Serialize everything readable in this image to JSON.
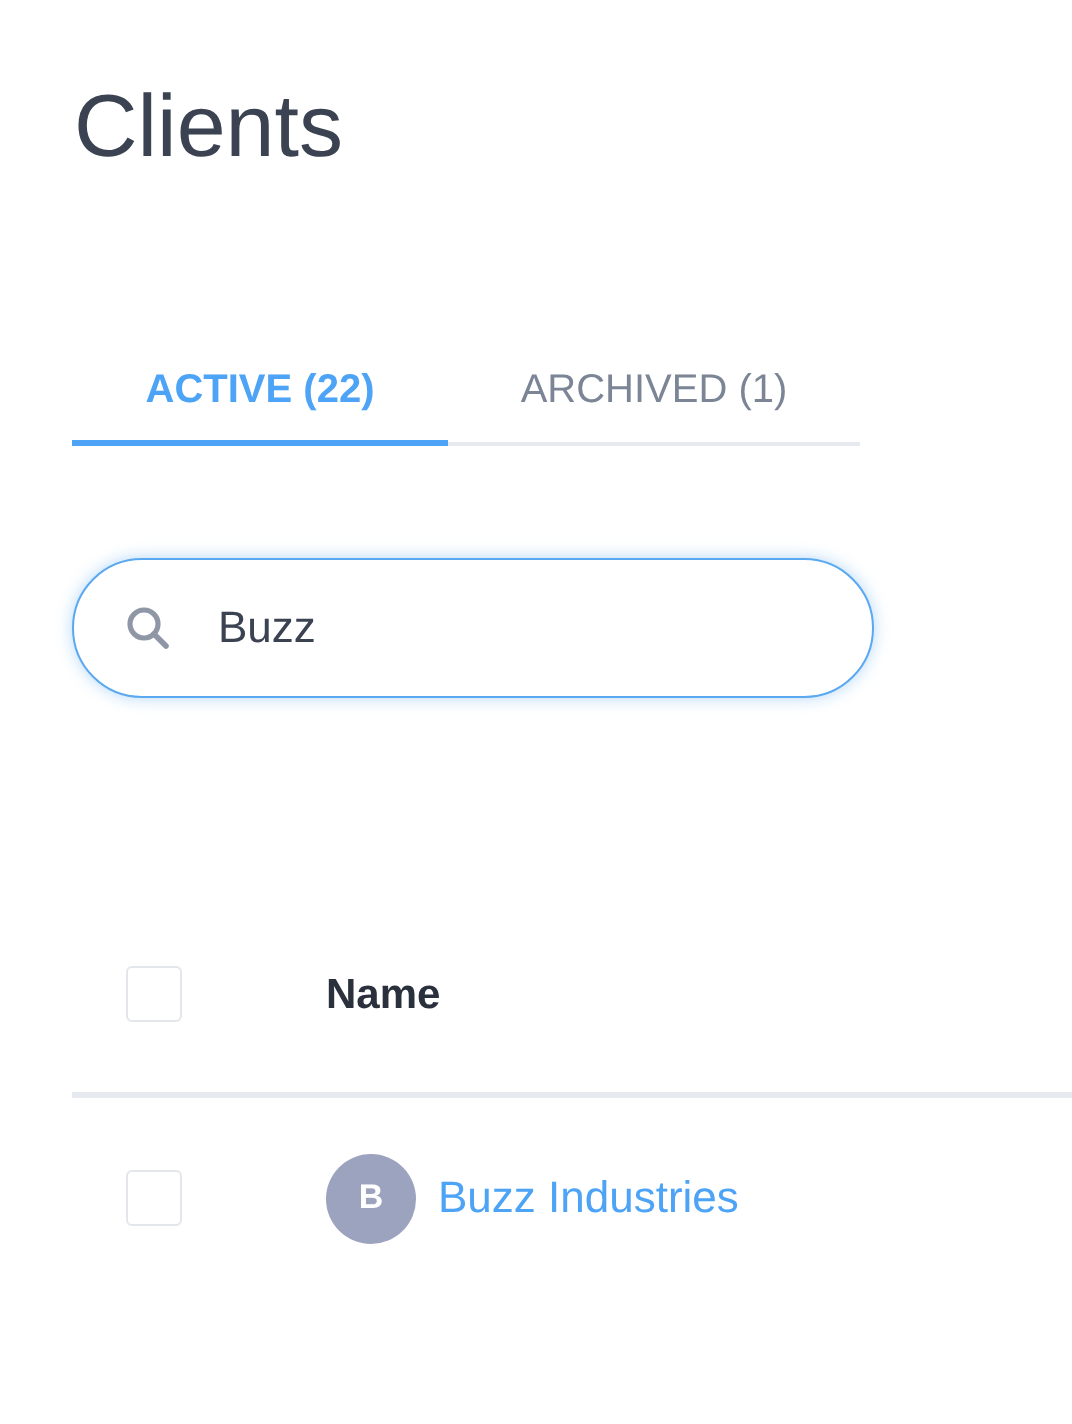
{
  "page": {
    "title": "Clients"
  },
  "tabs": [
    {
      "label": "ACTIVE (22)",
      "selected": true
    },
    {
      "label": "ARCHIVED (1)",
      "selected": false
    }
  ],
  "search": {
    "value": "Buzz",
    "focused": true
  },
  "table": {
    "columns": [
      {
        "label": "Name"
      }
    ],
    "select_all": {
      "checked": false
    },
    "rows": [
      {
        "avatar": "B",
        "name": "Buzz Industries",
        "checked": false
      }
    ]
  }
}
